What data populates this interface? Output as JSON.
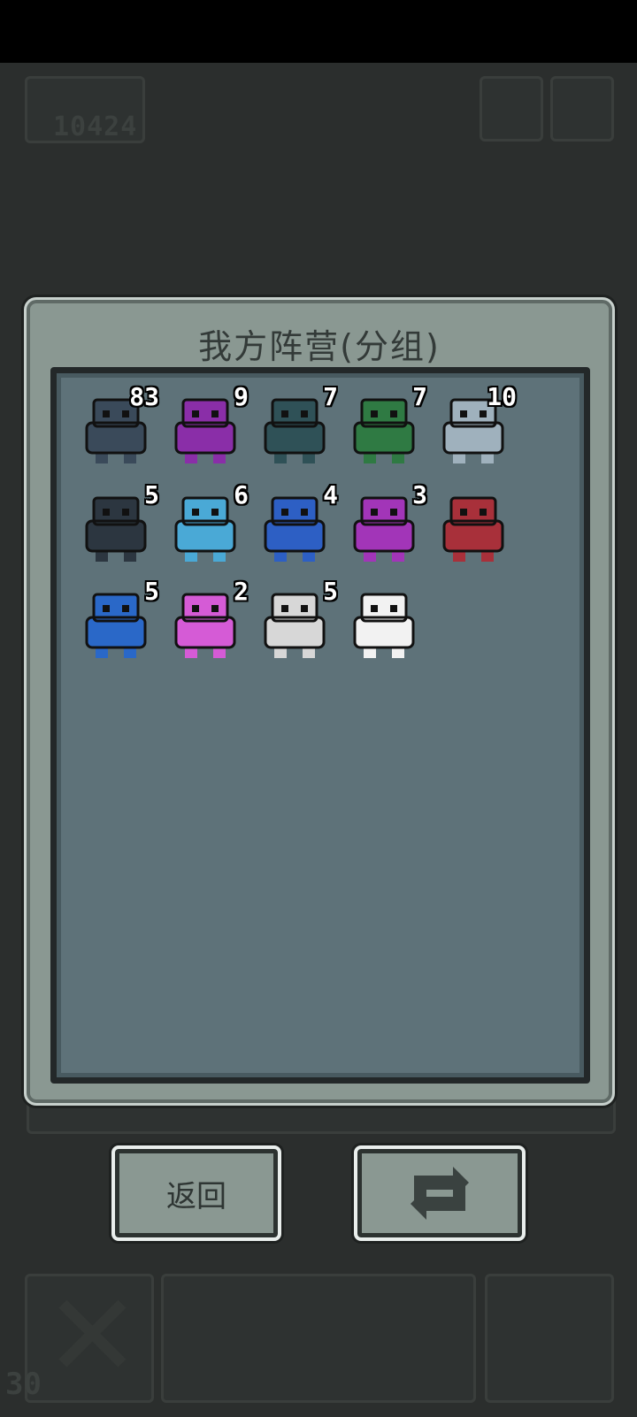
{
  "background": {
    "score": "10424",
    "level": "30"
  },
  "dialog": {
    "title": "我方阵营(分组)"
  },
  "units": [
    {
      "icon": "fish-monster-icon",
      "count": "83",
      "color": "#3a4a5a"
    },
    {
      "icon": "purple-dragon-icon",
      "count": "9",
      "color": "#8a2ea8"
    },
    {
      "icon": "cthulhu-icon",
      "count": "7",
      "color": "#2f5157"
    },
    {
      "icon": "minotaur-icon",
      "count": "7",
      "color": "#2f7a43"
    },
    {
      "icon": "bone-golem-icon",
      "count": "10",
      "color": "#9fb1bd"
    },
    {
      "icon": "dark-machine-icon",
      "count": "5",
      "color": "#2c3640"
    },
    {
      "icon": "ice-golem-icon",
      "count": "6",
      "color": "#4aa9d6"
    },
    {
      "icon": "clock-cube-icon",
      "count": "4",
      "color": "#2d5fc4"
    },
    {
      "icon": "purple-demon-icon",
      "count": "3",
      "color": "#a235b8"
    },
    {
      "icon": "red-boot-icon",
      "count": "",
      "color": "#a8303a"
    },
    {
      "icon": "rune-cube-icon",
      "count": "5",
      "color": "#2a68c8"
    },
    {
      "icon": "pink-demon-icon",
      "count": "2",
      "color": "#d55bd6"
    },
    {
      "icon": "white-wizard-icon",
      "count": "5",
      "color": "#d7d7d7"
    },
    {
      "icon": "white-ghost-icon",
      "count": "",
      "color": "#f2f2f2"
    }
  ],
  "buttons": {
    "back_label": "返回",
    "swap_icon": "swap-icon"
  }
}
